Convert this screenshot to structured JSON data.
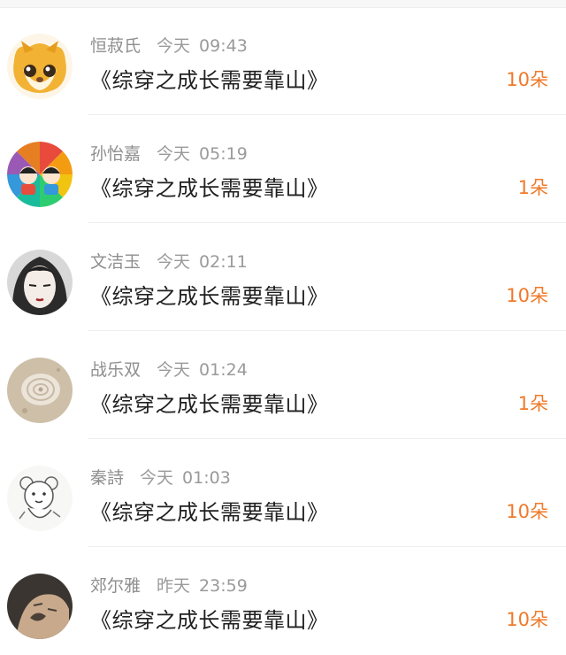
{
  "items": [
    {
      "name": "恒菽氏",
      "day": "今天",
      "time": "09:43",
      "book": "《综穿之成长需要靠山》",
      "gift": "10朵",
      "avatar": "cartoon-dog"
    },
    {
      "name": "孙怡嘉",
      "day": "今天",
      "time": "05:19",
      "book": "《综穿之成长需要靠山》",
      "gift": "1朵",
      "avatar": "rainbow-kids"
    },
    {
      "name": "文洁玉",
      "day": "今天",
      "time": "02:11",
      "book": "《综穿之成长需要靠山》",
      "gift": "10朵",
      "avatar": "anime-girl"
    },
    {
      "name": "战乐双",
      "day": "今天",
      "time": "01:24",
      "book": "《综穿之成长需要靠山》",
      "gift": "1朵",
      "avatar": "seashell"
    },
    {
      "name": "秦詩",
      "day": "今天",
      "time": "01:03",
      "book": "《综穿之成长需要靠山》",
      "gift": "10朵",
      "avatar": "sketch-bear"
    },
    {
      "name": "郊尔雅",
      "day": "昨天",
      "time": "23:59",
      "book": "《综穿之成长需要靠山》",
      "gift": "10朵",
      "avatar": "tattoo-hand"
    }
  ],
  "colors": {
    "gift": "#f07a2a",
    "meta": "#9a9a9a",
    "title": "#1f1f1f"
  }
}
